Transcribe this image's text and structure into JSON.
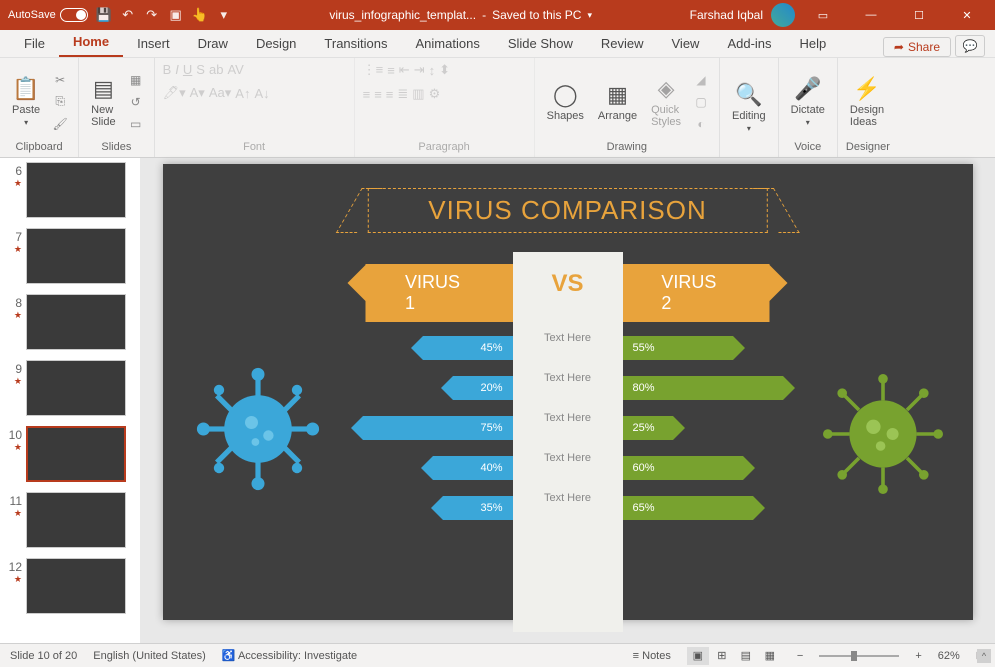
{
  "titlebar": {
    "autosave": "AutoSave",
    "filename": "virus_infographic_templat...",
    "save_status": "Saved to this PC",
    "username": "Farshad Iqbal"
  },
  "tabs": {
    "file": "File",
    "home": "Home",
    "insert": "Insert",
    "draw": "Draw",
    "design": "Design",
    "transitions": "Transitions",
    "animations": "Animations",
    "slideshow": "Slide Show",
    "review": "Review",
    "view": "View",
    "addins": "Add-ins",
    "help": "Help",
    "share": "Share"
  },
  "ribbon": {
    "clipboard": {
      "label": "Clipboard",
      "paste": "Paste"
    },
    "slides": {
      "label": "Slides",
      "new_slide": "New\nSlide"
    },
    "font": {
      "label": "Font"
    },
    "paragraph": {
      "label": "Paragraph"
    },
    "drawing": {
      "label": "Drawing",
      "shapes": "Shapes",
      "arrange": "Arrange",
      "quick_styles": "Quick\nStyles"
    },
    "editing": {
      "label": "Editing",
      "btn": "Editing"
    },
    "voice": {
      "label": "Voice",
      "dictate": "Dictate"
    },
    "designer": {
      "label": "Designer",
      "design_ideas": "Design\nIdeas"
    }
  },
  "thumbs": [
    {
      "num": "6"
    },
    {
      "num": "7"
    },
    {
      "num": "8"
    },
    {
      "num": "9"
    },
    {
      "num": "10"
    },
    {
      "num": "11"
    },
    {
      "num": "12"
    }
  ],
  "slide": {
    "title": "VIRUS COMPARISON",
    "virus1": "VIRUS 1",
    "virus2": "VIRUS 2",
    "vs": "VS",
    "text_here": "Text Here",
    "rows": [
      {
        "left": "45%",
        "lw": 90,
        "right": "55%",
        "rw": 110
      },
      {
        "left": "20%",
        "lw": 60,
        "right": "80%",
        "rw": 160
      },
      {
        "left": "75%",
        "lw": 150,
        "right": "25%",
        "rw": 50
      },
      {
        "left": "40%",
        "lw": 80,
        "right": "60%",
        "rw": 120
      },
      {
        "left": "35%",
        "lw": 70,
        "right": "65%",
        "rw": 130
      }
    ]
  },
  "status": {
    "slide_count": "Slide 10 of 20",
    "language": "English (United States)",
    "accessibility": "Accessibility: Investigate",
    "notes": "Notes",
    "zoom": "62%"
  },
  "chart_data": {
    "type": "bar",
    "title": "VIRUS COMPARISON",
    "categories": [
      "Text Here",
      "Text Here",
      "Text Here",
      "Text Here",
      "Text Here"
    ],
    "series": [
      {
        "name": "VIRUS 1",
        "values": [
          45,
          20,
          75,
          40,
          35
        ]
      },
      {
        "name": "VIRUS 2",
        "values": [
          55,
          80,
          25,
          60,
          65
        ]
      }
    ],
    "xlabel": "",
    "ylabel": "",
    "ylim": [
      0,
      100
    ]
  }
}
